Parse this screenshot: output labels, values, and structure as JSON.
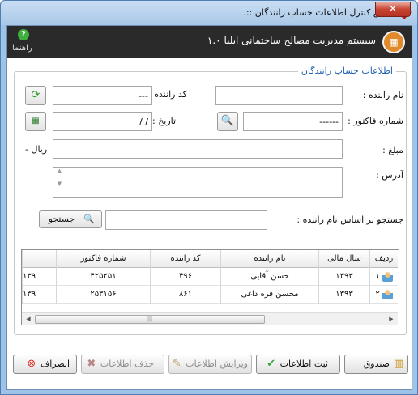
{
  "window": {
    "title": "بخش کنترل اطلاعات حساب رانندگان ::.",
    "close_label": "✕"
  },
  "banner": {
    "title": "سیستم مدیریت مصالح ساختمانی ایلیا ۱.۰",
    "help_label": "راهنما",
    "help_glyph": "?"
  },
  "form": {
    "group_title": "اطلاعات حساب رانندگان",
    "driver_name_label": "نام راننده :",
    "driver_name_value": "",
    "driver_code_label": "کد راننده :",
    "driver_code_value": "---",
    "invoice_label": "شماره فاکتور :",
    "invoice_value": "------",
    "date_label": "تاریخ :",
    "date_value": "/ /",
    "amount_label": "مبلغ :",
    "amount_value": "",
    "currency": "ریال -",
    "address_label": "آدرس :",
    "address_value": "",
    "search_label": "جستجو بر اساس نام راننده :",
    "search_value": "",
    "search_button": "جستجو"
  },
  "grid": {
    "headers": [
      "ردیف",
      "سال مالی",
      "نام راننده",
      "کد راننده",
      "شماره فاکتور",
      ""
    ],
    "rows": [
      [
        "۱",
        "۱۳۹۳",
        "حسن آقایی",
        "۴۹۶",
        "۴۲۵۲۵۱",
        "۱۳۹"
      ],
      [
        "۲",
        "۱۳۹۳",
        "محسن قره داغی",
        "۸۶۱",
        "۲۵۳۱۵۶",
        "۱۳۹"
      ]
    ]
  },
  "actions": {
    "cashbox": "صندوق",
    "save": "ثبت اطلاعات",
    "edit": "ویرایش اطلاعات",
    "delete": "حذف اطلاعات",
    "cancel": "انصراف"
  },
  "colors": {
    "accent": "#1d5fae",
    "banner_bg": "#2a2a2a",
    "close": "#c74433"
  }
}
